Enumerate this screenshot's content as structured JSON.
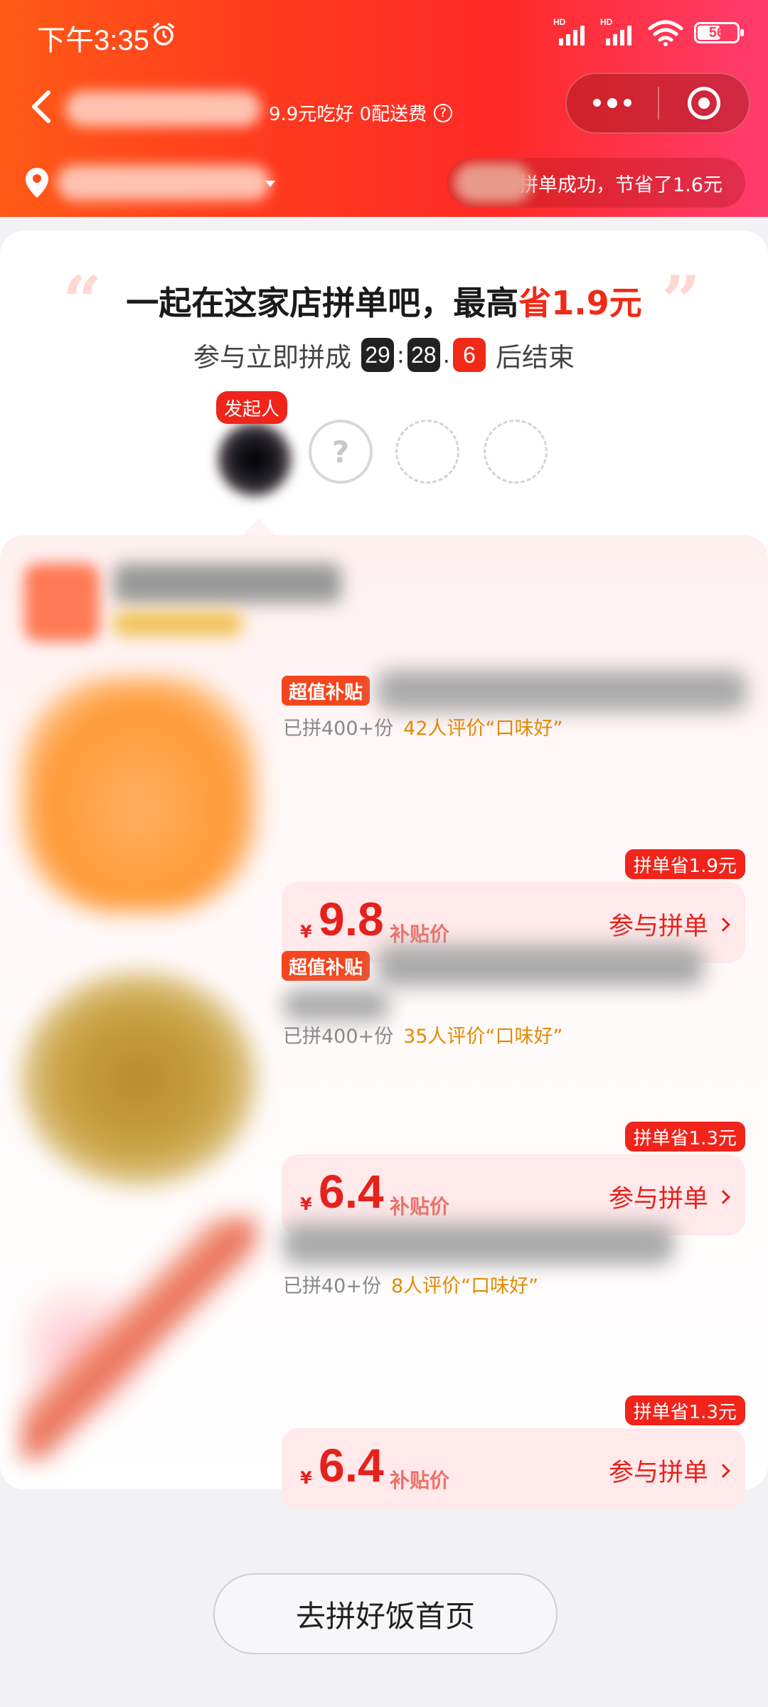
{
  "status_bar": {
    "time": "下午3:35",
    "battery": "56",
    "signal_label": "HD"
  },
  "header": {
    "subtitle": "9.9元吃好 0配送费",
    "help_symbol": "?",
    "notice": "拼单成功，节省了1.6元"
  },
  "banner": {
    "headline_prefix": "一起在这家店拼单吧，最高",
    "headline_highlight": "省1.9元",
    "open_quote": "“",
    "close_quote": "”",
    "countdown_prefix": "参与立即拼成",
    "countdown": {
      "a": "29",
      "b": "28",
      "c": "6"
    },
    "countdown_sep1": ":",
    "countdown_sep2": ".",
    "countdown_suffix": "后结束",
    "initiator_label": "发起人",
    "empty_slot_symbol": "?"
  },
  "items": [
    {
      "tag": "超值补贴",
      "sold": "已拼400+份",
      "reviews": "42人评价“口味好”",
      "currency": "¥",
      "price": "9.8",
      "price_label": "补贴价",
      "join": "参与拼单",
      "save": "拼单省1.9元"
    },
    {
      "tag": "超值补贴",
      "sold": "已拼400+份",
      "reviews": "35人评价“口味好”",
      "currency": "¥",
      "price": "6.4",
      "price_label": "补贴价",
      "join": "参与拼单",
      "save": "拼单省1.3元"
    },
    {
      "tag": "",
      "sold": "已拼40+份",
      "reviews": "8人评价“口味好”",
      "currency": "¥",
      "price": "6.4",
      "price_label": "补贴价",
      "join": "参与拼单",
      "save": "拼单省1.3元"
    }
  ],
  "footer": {
    "home_button": "去拼好饭首页"
  },
  "colors": {
    "brand_red": "#f0241b",
    "price_red": "#e6211c",
    "review_orange": "#e28a05"
  }
}
